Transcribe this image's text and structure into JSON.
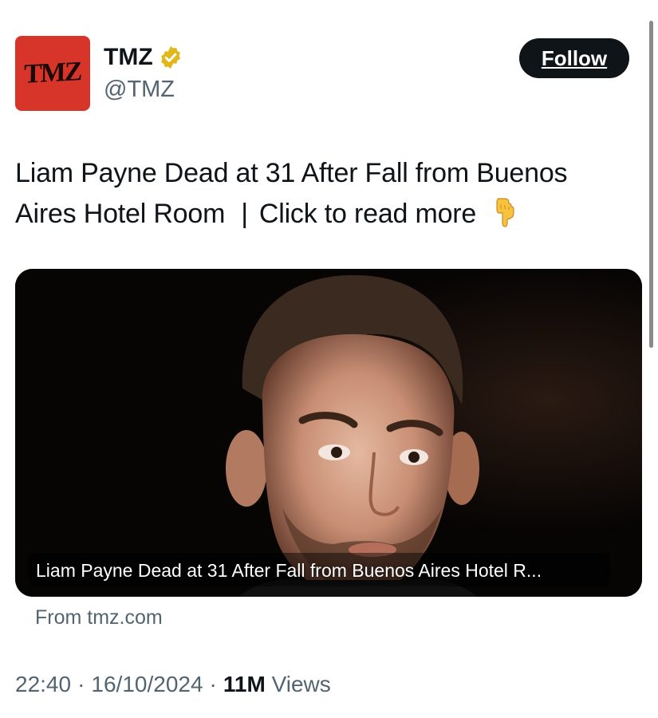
{
  "author": {
    "avatar_text": "TMZ",
    "display_name": "TMZ",
    "handle": "@TMZ",
    "verified": true,
    "verified_badge_color": "#e2b719"
  },
  "follow_button": {
    "label": "Follow"
  },
  "tweet": {
    "text_main": "Liam Payne Dead at 31 After Fall from Buenos Aires Hotel Room",
    "separator": "|",
    "text_cta": "Click to read more",
    "emoji": "backhand-index-pointing-down"
  },
  "link_card": {
    "caption": "Liam Payne Dead at 31 After Fall from Buenos Aires Hotel R...",
    "source": "From tmz.com"
  },
  "meta": {
    "time": "22:40",
    "date": "16/10/2024",
    "views_count": "11M",
    "views_label": "Views",
    "separator": "·"
  },
  "colors": {
    "brand_red": "#d8352a",
    "text_primary": "#0f1419",
    "text_secondary": "#536471"
  }
}
